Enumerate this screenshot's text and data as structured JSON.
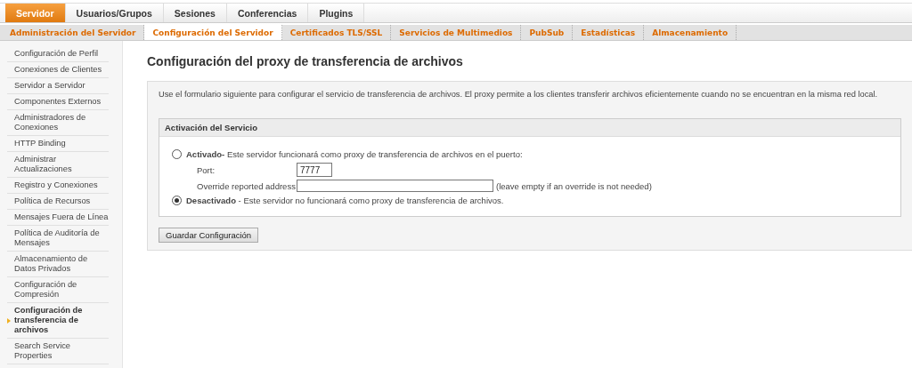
{
  "main_tabs": [
    {
      "label": "Servidor",
      "selected": true
    },
    {
      "label": "Usuarios/Grupos",
      "selected": false
    },
    {
      "label": "Sesiones",
      "selected": false
    },
    {
      "label": "Conferencias",
      "selected": false
    },
    {
      "label": "Plugins",
      "selected": false
    }
  ],
  "sub_tabs": [
    {
      "label": "Administración del Servidor",
      "selected": false
    },
    {
      "label": "Configuración del Servidor",
      "selected": true
    },
    {
      "label": "Certificados TLS/SSL",
      "selected": false
    },
    {
      "label": "Servicios de Multimedios",
      "selected": false
    },
    {
      "label": "PubSub",
      "selected": false
    },
    {
      "label": "Estadísticas",
      "selected": false
    },
    {
      "label": "Almacenamiento",
      "selected": false
    }
  ],
  "sidebar": {
    "items": [
      {
        "label": "Configuración de Perfil",
        "selected": false
      },
      {
        "label": "Conexiones de Clientes",
        "selected": false
      },
      {
        "label": "Servidor a Servidor",
        "selected": false
      },
      {
        "label": "Componentes Externos",
        "selected": false
      },
      {
        "label": "Administradores de Conexiones",
        "selected": false
      },
      {
        "label": "HTTP Binding",
        "selected": false
      },
      {
        "label": "Administrar Actualizaciones",
        "selected": false
      },
      {
        "label": "Registro y Conexiones",
        "selected": false
      },
      {
        "label": "Política de Recursos",
        "selected": false
      },
      {
        "label": "Mensajes Fuera de Línea",
        "selected": false
      },
      {
        "label": "Política de Auditoría de Mensajes",
        "selected": false
      },
      {
        "label": "Almacenamiento de Datos Privados",
        "selected": false
      },
      {
        "label": "Configuración de Compresión",
        "selected": false
      },
      {
        "label": "Configuración de transferencia de archivos",
        "selected": true
      },
      {
        "label": "Search Service Properties",
        "selected": false
      }
    ]
  },
  "page": {
    "title": "Configuración del proxy de transferencia de archivos",
    "description": "Use el formulario siguiente para configurar el servicio de transferencia de archivos. El proxy permite a los clientes transferir archivos eficientemente cuando no se encuentran en la misma red local.",
    "section": {
      "title": "Activación del Servicio",
      "options": [
        {
          "label": "**Activado-** Este servidor funcionará como proxy de transferencia de archivos en el puerto:",
          "selected": false,
          "fields": [
            {
              "label": "Port:",
              "value": "7777",
              "kind": "port"
            },
            {
              "label": "Override reported address",
              "kind": "address",
              "hint": "(leave empty if an override is not needed)"
            }
          ]
        },
        {
          "label": "**Desactivado** - Este servidor no funcionará como proxy de transferencia de archivos.",
          "selected": true
        }
      ]
    },
    "save_button": "Guardar Configuración"
  }
}
